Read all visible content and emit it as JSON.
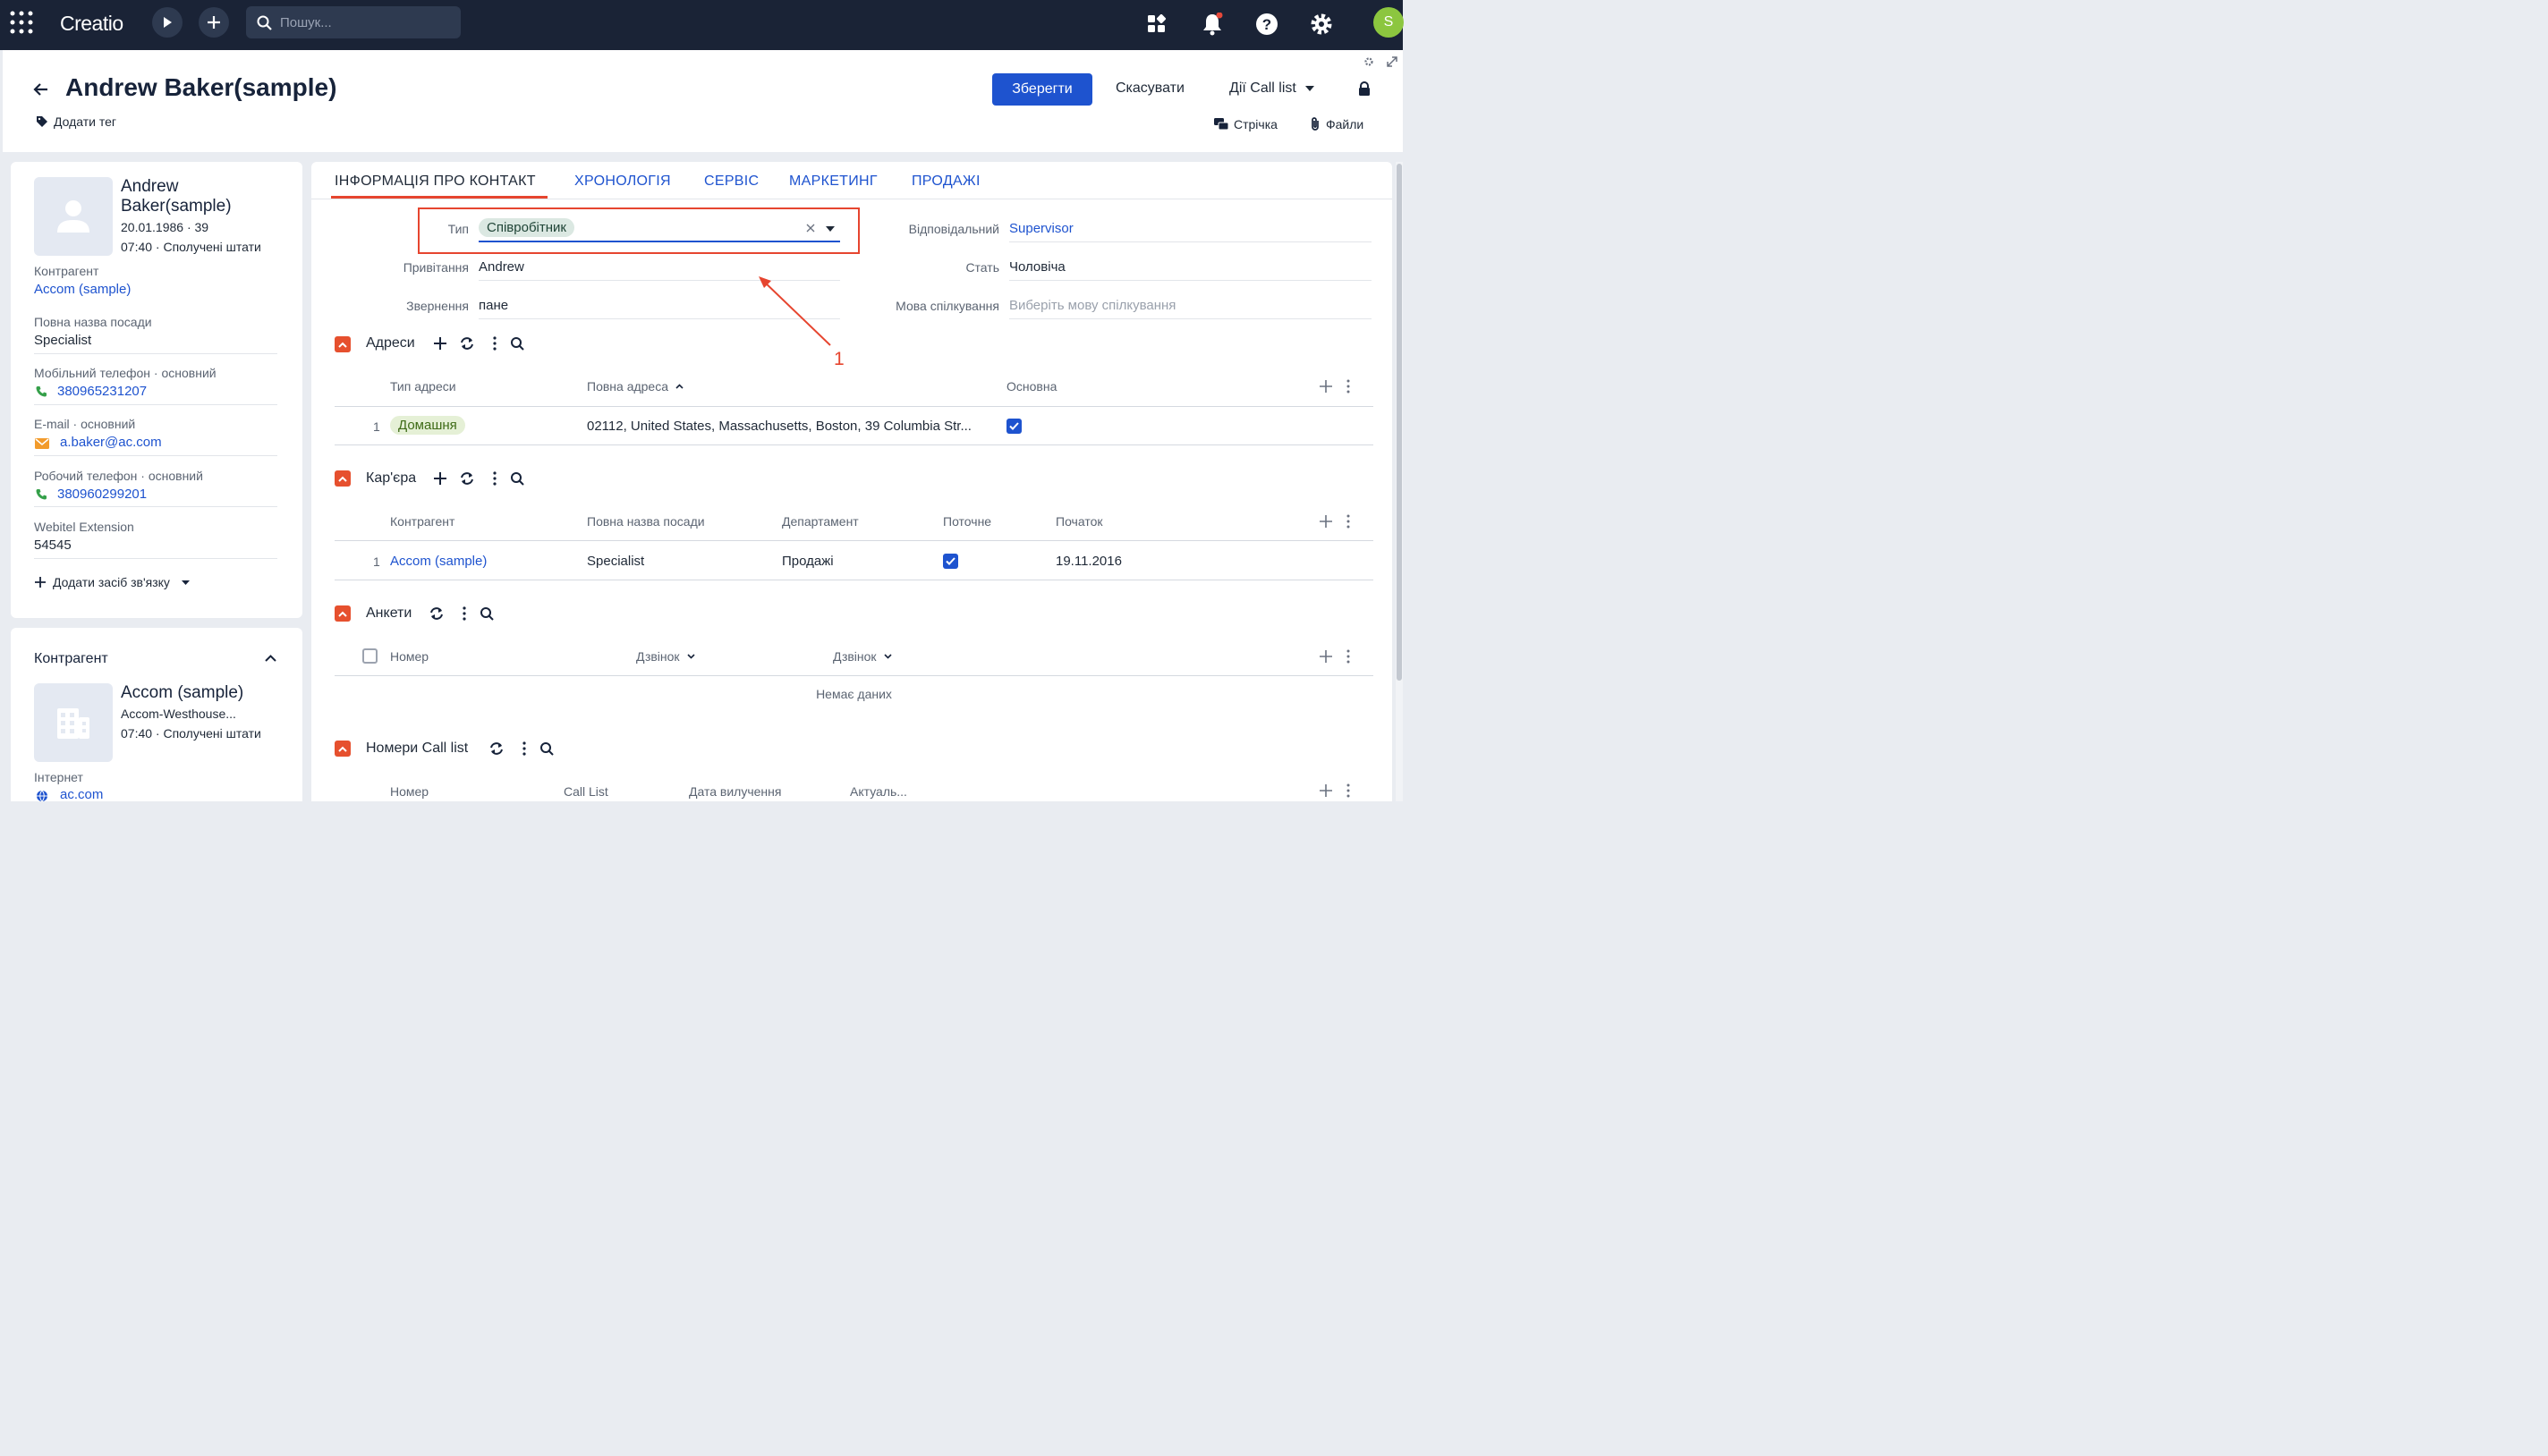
{
  "topbar": {
    "logo": "Creatio",
    "search_placeholder": "Пошук...",
    "avatar_letter": "S",
    "icons": [
      "apps-grid-icon",
      "run-icon",
      "add-icon",
      "search-icon",
      "widgets-icon",
      "bell-icon",
      "help-icon",
      "gear-icon"
    ]
  },
  "header": {
    "title": "Andrew Baker(sample)",
    "add_tag": "Додати тег",
    "save": "Зберегти",
    "cancel": "Скасувати",
    "actions": "Дії Call list",
    "feed": "Стрічка",
    "files": "Файли"
  },
  "profile": {
    "name_line1": "Andrew",
    "name_line2": "Baker(sample)",
    "birth": "20.01.1986 · 39",
    "time_country": "07:40 · Сполучені штати",
    "fields": [
      {
        "label": "Контрагент",
        "value": "Accom (sample)"
      },
      {
        "label": "Повна назва посади",
        "value": "Specialist"
      },
      {
        "label": "Мобільний телефон · основний",
        "value": "380965231207"
      },
      {
        "label": "E-mail · основний",
        "value": "a.baker@ac.com"
      },
      {
        "label": "Робочий телефон · основний",
        "value": "380960299201"
      },
      {
        "label": "Webitel Extension",
        "value": "54545"
      }
    ],
    "add_contact": "Додати засіб зв'язку"
  },
  "account_card": {
    "title": "Контрагент",
    "name": "Accom (sample)",
    "subtitle": "Accom-Westhouse...",
    "time_country": "07:40 · Сполучені штати",
    "web_label": "Інтернет",
    "web_value": "ac.com"
  },
  "tabs": [
    "ІНФОРМАЦІЯ ПРО КОНТАКТ",
    "ХРОНОЛОГІЯ",
    "СЕРВІС",
    "МАРКЕТИНГ",
    "ПРОДАЖІ"
  ],
  "form": {
    "type_label": "Тип",
    "type_value": "Співробітник",
    "greeting_label": "Привітання",
    "greeting_value": "Andrew",
    "salutation_label": "Звернення",
    "salutation_value": "пане",
    "owner_label": "Відповідальний",
    "owner_value": "Supervisor",
    "gender_label": "Стать",
    "gender_value": "Чоловіча",
    "language_label": "Мова спілкування",
    "language_placeholder": "Виберіть мову спілкування"
  },
  "annotation": {
    "number": "1",
    "color": "#e6452f"
  },
  "addresses": {
    "title": "Адреси",
    "columns": [
      "Тип адреси",
      "Повна адреса",
      "Основна"
    ],
    "rows": [
      {
        "num": "1",
        "type": "Домашня",
        "address": "02112, United States, Massachusetts, Boston, 39 Columbia Str...",
        "primary": true
      }
    ]
  },
  "career": {
    "title": "Кар'єра",
    "columns": [
      "Контрагент",
      "Повна назва посади",
      "Департамент",
      "Поточне",
      "Початок"
    ],
    "rows": [
      {
        "num": "1",
        "account": "Accom (sample)",
        "job": "Specialist",
        "department": "Продажі",
        "current": true,
        "start": "19.11.2016"
      }
    ]
  },
  "surveys": {
    "title": "Анкети",
    "columns": [
      "Номер",
      "Дзвінок",
      "Дзвінок"
    ],
    "empty": "Немає даних"
  },
  "calllist": {
    "title": "Номери Call list",
    "columns": [
      "Номер",
      "Call List",
      "Дата вилучення",
      "Актуаль..."
    ]
  },
  "colors": {
    "accent": "#1e53cf",
    "topbar": "#1a2336",
    "section_toggle": "#e6502e",
    "notification": "#e5483a",
    "avatar": "#8cc63f"
  }
}
